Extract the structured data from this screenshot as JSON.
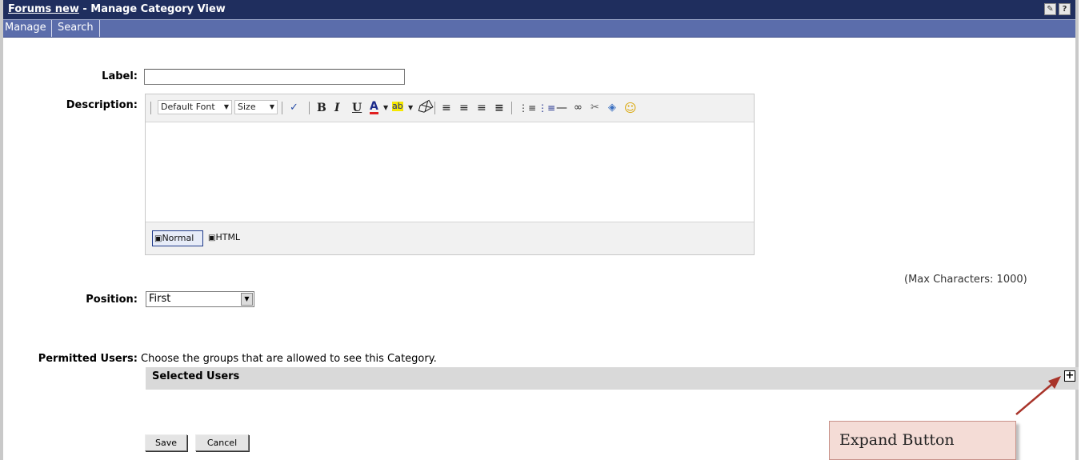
{
  "header": {
    "link_text": "Forums new",
    "title_rest": " - Manage Category View",
    "icons": [
      "settings-tool-icon",
      "help-icon"
    ],
    "help_glyph": "?"
  },
  "nav": {
    "items": [
      "Manage",
      "Search"
    ]
  },
  "form": {
    "label_label": "Label:",
    "label_value": "",
    "description_label": "Description:",
    "editor": {
      "font_dropdown": "Default Font",
      "size_dropdown": "Size",
      "content": "",
      "mode_normal": "Normal",
      "mode_html": "HTML"
    },
    "max_chars": "(Max Characters: 1000)",
    "position_label": "Position:",
    "position_value": "First",
    "permitted_label": "Permitted Users:",
    "permitted_desc": "Choose the groups that are allowed to see this Category.",
    "selected_users": "Selected Users"
  },
  "buttons": {
    "save": "Save",
    "cancel": "Cancel"
  },
  "callout": {
    "text": "Expand Button"
  },
  "colors": {
    "title_bg": "#1f2e5e",
    "nav_bg": "#5b6dab",
    "callout_bg": "#f4dcd6",
    "arrow": "#a8342a"
  }
}
